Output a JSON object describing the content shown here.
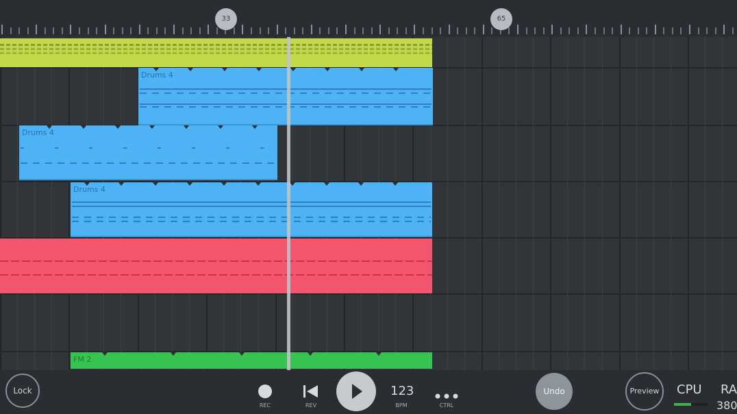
{
  "ruler": {
    "markers": [
      "33",
      "65"
    ]
  },
  "clips": [
    {
      "id": "lime-clip",
      "label": "",
      "color": "#c2d84a"
    },
    {
      "id": "drums-clip-1",
      "label": "Drums 4",
      "color": "#4db3f5"
    },
    {
      "id": "drums-clip-2",
      "label": "Drums 4",
      "color": "#4db3f5"
    },
    {
      "id": "drums-clip-3",
      "label": "Drums 4",
      "color": "#4db3f5"
    },
    {
      "id": "pink-clip",
      "label": "",
      "color": "#f2566e"
    },
    {
      "id": "fm-clip",
      "label": "FM 2",
      "color": "#38c24f"
    }
  ],
  "toolbar": {
    "lock": "Lock",
    "rec": "REC",
    "rev": "REV",
    "tempo": "123",
    "bpm": "BPM",
    "ctrl": "CTRL",
    "undo": "Undo",
    "preview": "Preview",
    "cpu": "CPU",
    "ram": "RA",
    "ram_value": "380",
    "cpu_load": 0.5
  },
  "colors": {
    "background": "#2b2f34",
    "accent_green": "#3fb24f"
  }
}
